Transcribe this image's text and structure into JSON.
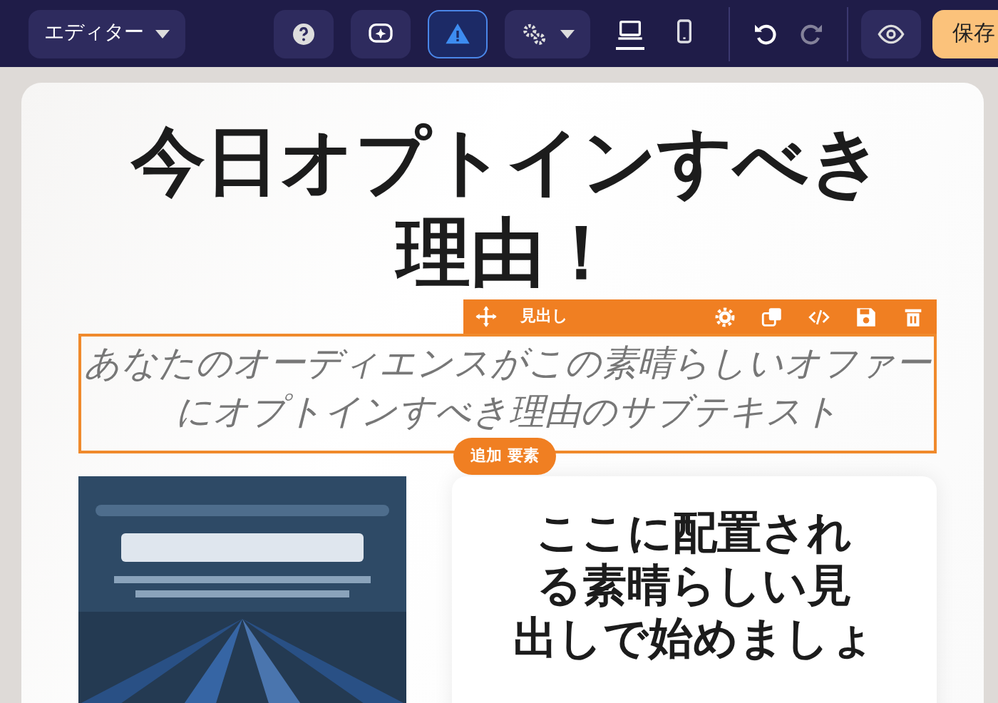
{
  "topbar": {
    "editor_menu": {
      "label": "エディター"
    },
    "tools": [
      {
        "kind": "help",
        "active": false
      },
      {
        "kind": "ai",
        "active": false
      },
      {
        "kind": "warning",
        "active": true
      },
      {
        "kind": "settings",
        "active": false,
        "dropdown": true
      }
    ],
    "devices": [
      {
        "kind": "desktop",
        "selected": true
      },
      {
        "kind": "mobile",
        "selected": false
      }
    ],
    "history": [
      {
        "kind": "undo",
        "disabled": false
      },
      {
        "kind": "redo",
        "disabled": true
      }
    ],
    "preview": {
      "kind": "eye"
    },
    "save": {
      "label": "保存"
    }
  },
  "page": {
    "heading": "今日オプトインすべき理由！",
    "selected_element": {
      "label": "見出し",
      "text": "あなたのオーディエンスがこの素晴らしいオファーにオプトインすべき理由のサブテキスト",
      "actions": [
        {
          "kind": "settings"
        },
        {
          "kind": "duplicate"
        },
        {
          "kind": "code"
        },
        {
          "kind": "save"
        },
        {
          "kind": "delete"
        }
      ]
    },
    "add_button": {
      "label": "追加 要素"
    },
    "card": {
      "heading_lines": [
        "ここに配置され",
        "る素晴らしい見",
        "出しで始めましょ"
      ]
    }
  }
}
